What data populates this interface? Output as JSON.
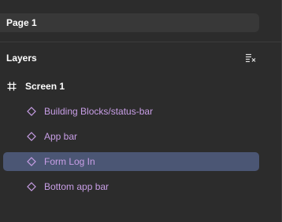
{
  "pages": {
    "current": "Page 1"
  },
  "layers_panel": {
    "title": "Layers",
    "collapse_icon": "collapse-layers-icon"
  },
  "tree": {
    "frame": {
      "label": "Screen 1",
      "icon": "frame-icon"
    },
    "children": [
      {
        "label": "Building Blocks/status-bar",
        "icon": "component-instance-icon",
        "selected": false
      },
      {
        "label": "App bar",
        "icon": "component-instance-icon",
        "selected": false
      },
      {
        "label": "Form Log In",
        "icon": "component-instance-icon",
        "selected": true
      },
      {
        "label": "Bottom app bar",
        "icon": "component-instance-icon",
        "selected": false
      }
    ]
  },
  "colors": {
    "panel_bg": "#2c2c2c",
    "row_bg": "#383838",
    "selected_bg": "#4b5674",
    "component_purple": "#c89ee6",
    "text": "#ffffff"
  }
}
